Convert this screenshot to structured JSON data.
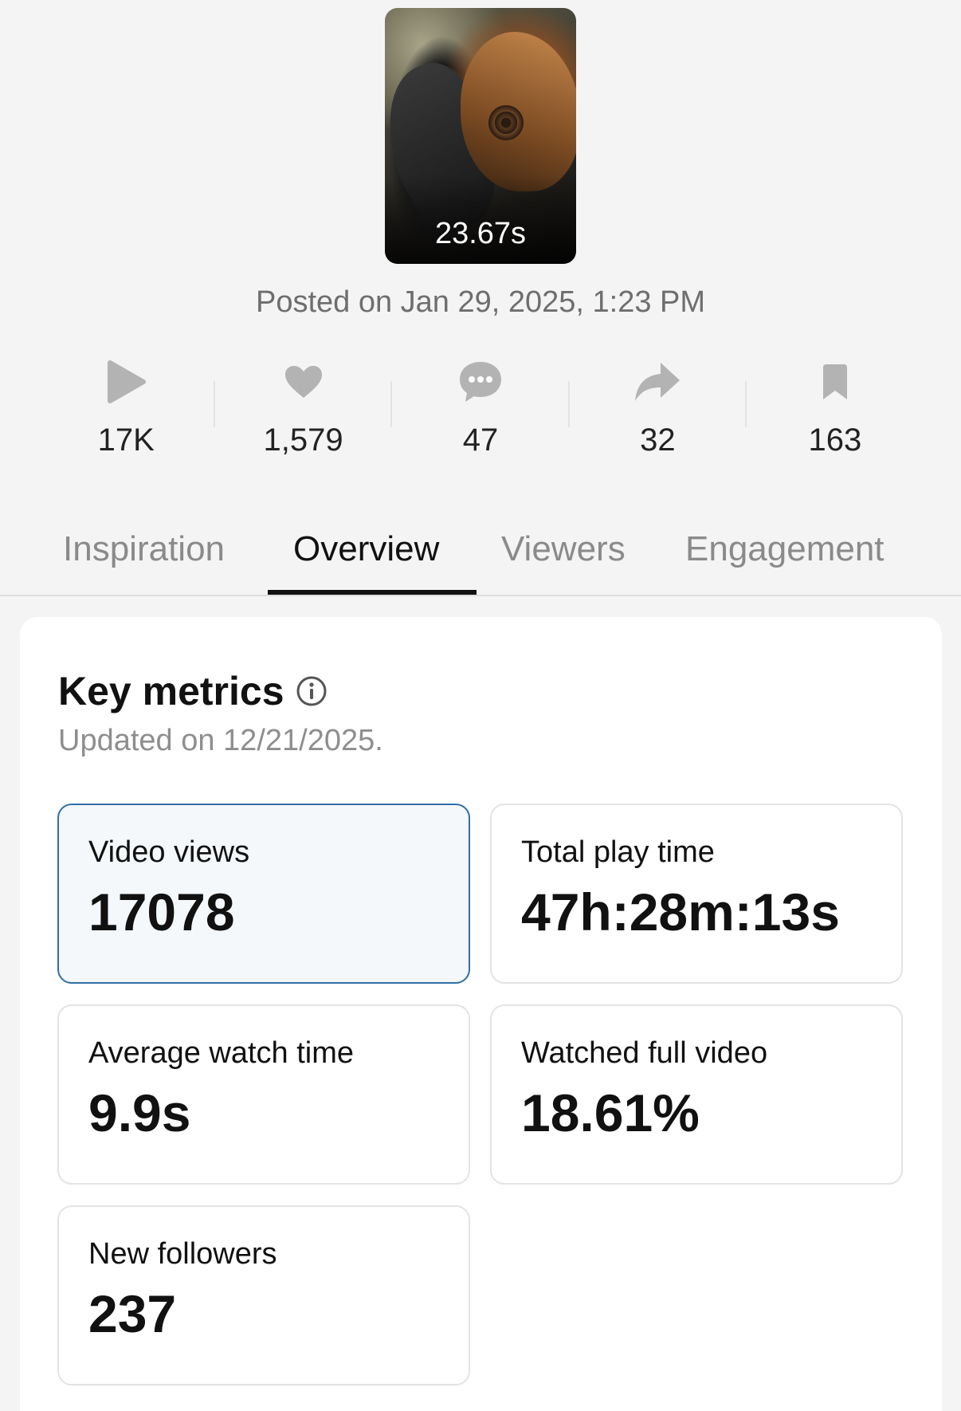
{
  "video": {
    "duration": "23.67s",
    "posted": "Posted on Jan 29, 2025, 1:23 PM"
  },
  "stats": [
    {
      "icon": "play-icon",
      "value": "17K"
    },
    {
      "icon": "heart-icon",
      "value": "1,579"
    },
    {
      "icon": "comment-icon",
      "value": "47"
    },
    {
      "icon": "share-icon",
      "value": "32"
    },
    {
      "icon": "bookmark-icon",
      "value": "163"
    }
  ],
  "tabs": {
    "inspiration": "Inspiration",
    "overview": "Overview",
    "viewers": "Viewers",
    "engagement": "Engagement",
    "active": "Overview"
  },
  "key_metrics": {
    "title": "Key metrics",
    "updated": "Updated on 12/21/2025.",
    "items": [
      {
        "label": "Video views",
        "value": "17078"
      },
      {
        "label": "Total play time",
        "value": "47h:28m:13s"
      },
      {
        "label": "Average watch time",
        "value": "9.9s"
      },
      {
        "label": "Watched full video",
        "value": "18.61%"
      },
      {
        "label": "New followers",
        "value": "237"
      }
    ]
  },
  "colors": {
    "background": "#f4f4f4",
    "selected_border": "#2f6fa6",
    "selected_fill": "#f4f8fb",
    "muted_text": "#8a8a8a",
    "icon_gray": "#b3b3b3"
  }
}
